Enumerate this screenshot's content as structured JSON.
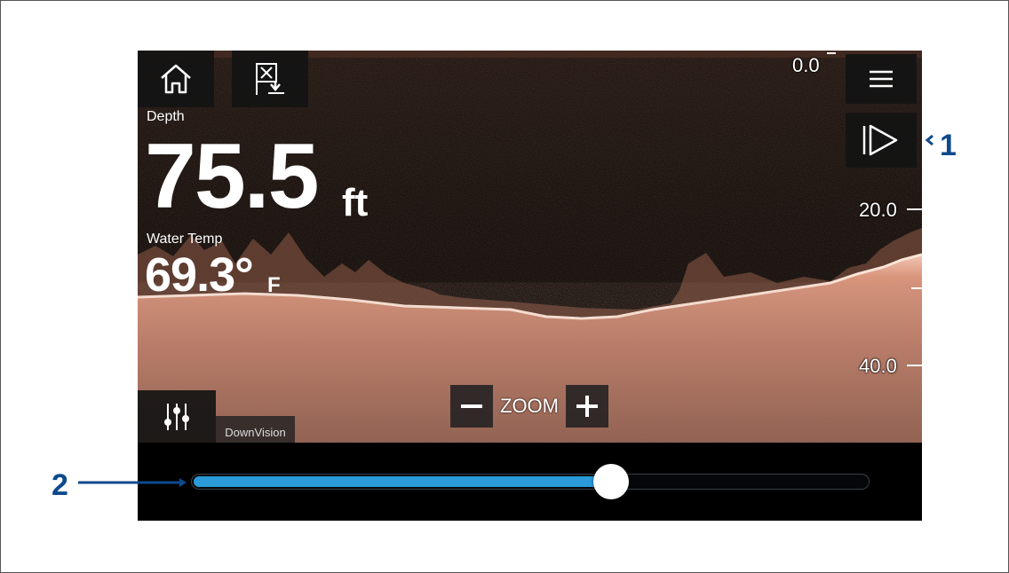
{
  "status": {
    "depth_label": "Depth",
    "depth_value": "75.5",
    "depth_unit": "ft",
    "temp_label": "Water Temp",
    "temp_value": "69.3°",
    "temp_unit": "F"
  },
  "toolbar": {
    "home_icon": "home-icon",
    "waypoint_icon": "waypoint-flag-icon",
    "menu_icon": "hamburger-menu-icon",
    "scroll_icon": "play-scroll-icon",
    "settings_icon": "sliders-icon"
  },
  "depth_scale": [
    "0.0",
    "20.0",
    "40.0"
  ],
  "zoom": {
    "minus": "−",
    "label": "ZOOM",
    "plus": "+"
  },
  "mode_label": "DownVision",
  "history_slider": {
    "position_fraction": 0.62,
    "fill_color": "#2a9ad8"
  },
  "callouts": [
    "1",
    "2"
  ],
  "colors": {
    "callout": "#0d4a8c",
    "sonar_bottom": "#c98c76"
  }
}
